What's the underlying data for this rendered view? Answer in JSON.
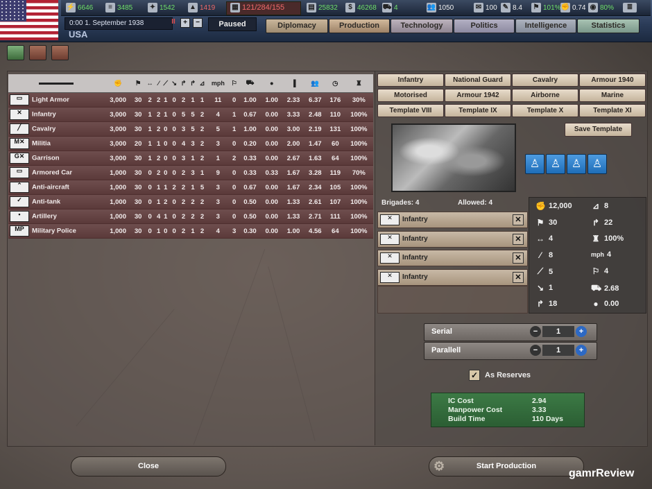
{
  "resources": {
    "energy": "6646",
    "metal": "3485",
    "rare": "1542",
    "oil": "1419",
    "ic": "121/284/155",
    "supplies": "25832",
    "money": "46268",
    "transport": "4",
    "manpower": "1050",
    "diplomacy": "100",
    "leadership": "8.4",
    "national_unity": "101%",
    "dissent": "0.74",
    "neutrality": "80%"
  },
  "date": "0:00 1. September 1938",
  "country": "USA",
  "status": "Paused",
  "pause_symbol": "II",
  "plus": "+",
  "minus": "−",
  "tabs": [
    "Diplomacy",
    "Production",
    "Technology",
    "Politics",
    "Intelligence",
    "Statistics"
  ],
  "colors": {
    "tab_active": "#b9a48a",
    "tab_inactive": "#a7a2ad",
    "tab_stats": "#9fb7a6"
  },
  "table": {
    "headers": [
      "✊",
      "⚑",
      "↔",
      "⁄",
      "⟋",
      "↘",
      "↱",
      "↱",
      "⊿",
      "mph",
      "⚐",
      "⛟",
      "●",
      "▐",
      "👥",
      "◷",
      "♜"
    ],
    "rows": [
      {
        "name": "Light Armor",
        "sym": "▭",
        "vals": [
          "3,000",
          "30",
          "2",
          "2",
          "1",
          "0",
          "2",
          "1",
          "1",
          "11",
          "0",
          "1.00",
          "1.00",
          "2.33",
          "6.37",
          "176",
          "30%"
        ]
      },
      {
        "name": "Infantry",
        "sym": "✕",
        "vals": [
          "3,000",
          "30",
          "1",
          "2",
          "1",
          "0",
          "5",
          "5",
          "2",
          "4",
          "1",
          "0.67",
          "0.00",
          "3.33",
          "2.48",
          "110",
          "100%"
        ]
      },
      {
        "name": "Cavalry",
        "sym": "╱",
        "vals": [
          "3,000",
          "30",
          "1",
          "2",
          "0",
          "0",
          "3",
          "5",
          "2",
          "5",
          "1",
          "1.00",
          "0.00",
          "3.00",
          "2.19",
          "131",
          "100%"
        ]
      },
      {
        "name": "Militia",
        "sym": "M✕",
        "vals": [
          "3,000",
          "20",
          "1",
          "1",
          "0",
          "0",
          "4",
          "3",
          "2",
          "3",
          "0",
          "0.20",
          "0.00",
          "2.00",
          "1.47",
          "60",
          "100%"
        ]
      },
      {
        "name": "Garrison",
        "sym": "G✕",
        "vals": [
          "3,000",
          "30",
          "1",
          "2",
          "0",
          "0",
          "3",
          "1",
          "2",
          "1",
          "2",
          "0.33",
          "0.00",
          "2.67",
          "1.63",
          "64",
          "100%"
        ]
      },
      {
        "name": "Armored Car",
        "sym": "▭",
        "vals": [
          "1,000",
          "30",
          "0",
          "2",
          "0",
          "0",
          "2",
          "3",
          "1",
          "9",
          "0",
          "0.33",
          "0.33",
          "1.67",
          "3.28",
          "119",
          "70%"
        ]
      },
      {
        "name": "Anti-aircraft",
        "sym": "⌃",
        "vals": [
          "1,000",
          "30",
          "0",
          "1",
          "1",
          "2",
          "2",
          "1",
          "5",
          "3",
          "0",
          "0.67",
          "0.00",
          "1.67",
          "2.34",
          "105",
          "100%"
        ]
      },
      {
        "name": "Anti-tank",
        "sym": "✓",
        "vals": [
          "1,000",
          "30",
          "0",
          "1",
          "2",
          "0",
          "2",
          "2",
          "2",
          "3",
          "0",
          "0.50",
          "0.00",
          "1.33",
          "2.61",
          "107",
          "100%"
        ]
      },
      {
        "name": "Artillery",
        "sym": "•",
        "vals": [
          "1,000",
          "30",
          "0",
          "4",
          "1",
          "0",
          "2",
          "2",
          "2",
          "3",
          "0",
          "0.50",
          "0.00",
          "1.33",
          "2.71",
          "111",
          "100%"
        ]
      },
      {
        "name": "Military Police",
        "sym": "MP",
        "vals": [
          "1,000",
          "30",
          "0",
          "1",
          "0",
          "0",
          "2",
          "1",
          "2",
          "4",
          "3",
          "0.30",
          "0.00",
          "1.00",
          "4.56",
          "64",
          "100%"
        ]
      }
    ]
  },
  "templates": [
    "Infantry",
    "National Guard",
    "Cavalry",
    "Armour 1940",
    "Motorised",
    "Armour 1942",
    "Airborne",
    "Marine",
    "Template VIII",
    "Template IX",
    "Template X",
    "Template XI"
  ],
  "save_template": "Save Template",
  "brigades": {
    "count_label": "Brigades: 4",
    "allowed_label": "Allowed: 4",
    "items": [
      "Infantry",
      "Infantry",
      "Infantry",
      "Infantry"
    ],
    "remove_symbol": "✕"
  },
  "stats": {
    "left": [
      {
        "icon": "✊",
        "value": "12,000"
      },
      {
        "icon": "⚑",
        "value": "30"
      },
      {
        "icon": "↔",
        "value": "4"
      },
      {
        "icon": "⁄",
        "value": "8"
      },
      {
        "icon": "⟋",
        "value": "5"
      },
      {
        "icon": "↘",
        "value": "1"
      },
      {
        "icon": "↱",
        "value": "18"
      }
    ],
    "right": [
      {
        "icon": "⊿",
        "value": "8"
      },
      {
        "icon": "↱",
        "value": "22"
      },
      {
        "icon": "♜",
        "value": "100%"
      },
      {
        "icon": "mph",
        "value": "4"
      },
      {
        "icon": "⚐",
        "value": "4"
      },
      {
        "icon": "⛟",
        "value": "2.68"
      },
      {
        "icon": "●",
        "value": "0.00"
      }
    ]
  },
  "serial": {
    "label": "Serial",
    "value": "1"
  },
  "parallel": {
    "label": "Parallell",
    "value": "1"
  },
  "reserves": {
    "label": "As Reserves",
    "checked": true,
    "mark": "✓"
  },
  "cost": {
    "ic_label": "IC Cost",
    "ic_value": "2.94",
    "mp_label": "Manpower Cost",
    "mp_value": "3.33",
    "time_label": "Build Time",
    "time_value": "110 Days"
  },
  "buttons": {
    "close": "Close",
    "start": "Start Production"
  },
  "watermark": "gamrReview"
}
